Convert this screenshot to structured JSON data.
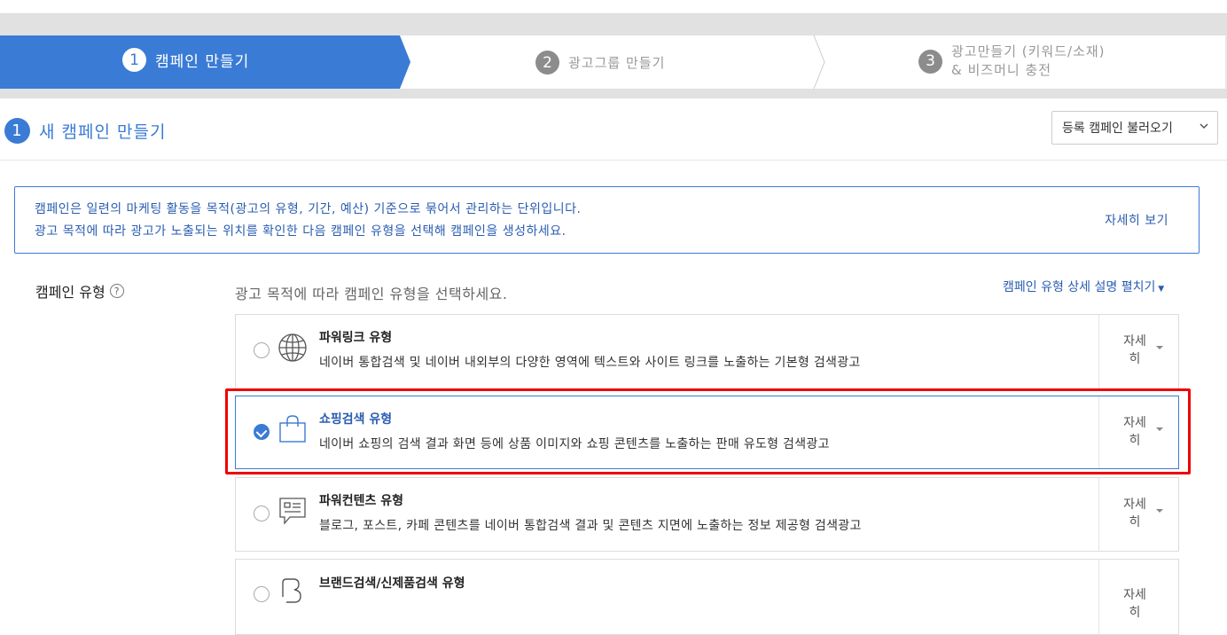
{
  "steps": [
    {
      "num": "1",
      "label": "캠페인 만들기"
    },
    {
      "num": "2",
      "label": "광고그룹 만들기"
    },
    {
      "num": "3",
      "label_line1": "광고만들기 (키워드/소재)",
      "label_line2": "& 비즈머니 충전"
    }
  ],
  "section": {
    "num": "1",
    "title": "새 캠페인 만들기",
    "load_button": "등록 캠페인 불러오기"
  },
  "info": {
    "line1": "캠페인은 일련의 마케팅 활동을 목적(광고의 유형, 기간, 예산) 기준으로 묶어서 관리하는 단위입니다.",
    "line2": "광고 목적에 따라 광고가 노출되는 위치를 확인한 다음 캠페인 유형을 선택해 캠페인을 생성하세요.",
    "link": "자세히 보기"
  },
  "campaign_type": {
    "label": "캠페인 유형",
    "help": "?",
    "instruction": "광고 목적에 따라 캠페인 유형을 선택하세요.",
    "expand_link": "캠페인 유형 상세 설명 펼치기",
    "options": [
      {
        "title": "파워링크 유형",
        "desc": "네이버 통합검색 및 네이버 내외부의 다양한 영역에 텍스트와 사이트 링크를 노출하는 기본형 검색광고",
        "detail_line1": "자세",
        "detail_line2": "히",
        "selected": false,
        "icon": "globe-icon"
      },
      {
        "title": "쇼핑검색 유형",
        "desc": "네이버 쇼핑의 검색 결과 화면 등에 상품 이미지와 쇼핑 콘텐츠를 노출하는 판매 유도형 검색광고",
        "detail_line1": "자세",
        "detail_line2": "히",
        "selected": true,
        "icon": "shopping-bag-icon"
      },
      {
        "title": "파워컨텐츠 유형",
        "desc": "블로그, 포스트, 카페 콘텐츠를 네이버 통합검색 결과 및 콘텐츠 지면에 노출하는 정보 제공형 검색광고",
        "detail_line1": "자세",
        "detail_line2": "히",
        "selected": false,
        "icon": "content-bubble-icon"
      },
      {
        "title": "브랜드검색/신제품검색 유형",
        "desc": "",
        "detail_line1": "자세",
        "detail_line2": "히",
        "selected": false,
        "icon": "brand-b-icon"
      }
    ]
  },
  "colors": {
    "accent": "#3a7bd5",
    "link": "#2a5db0",
    "highlight": "#ee0000"
  }
}
